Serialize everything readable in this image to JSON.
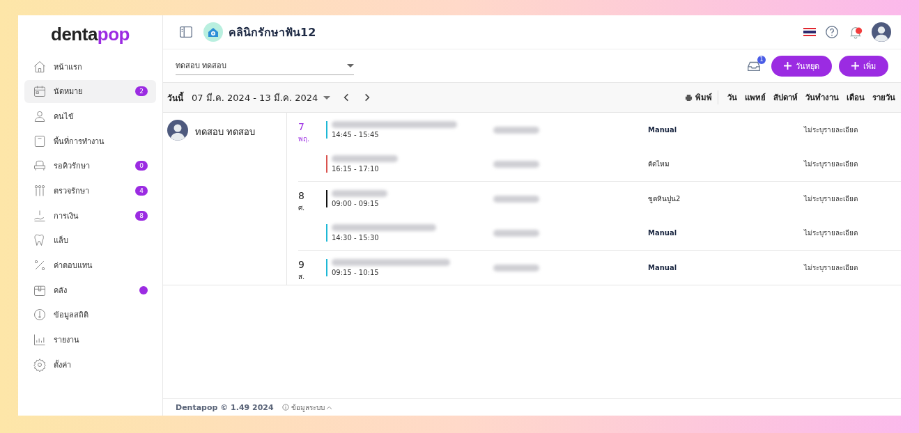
{
  "logo": {
    "part_1": "denta",
    "part_2": "pop"
  },
  "sidebar": {
    "items": [
      {
        "label": "หน้าแรก",
        "selected": false
      },
      {
        "label": "นัดหมาย",
        "selected": true,
        "badge": "2"
      },
      {
        "label": "คนไข้",
        "selected": false
      },
      {
        "label": "พื้นที่การทำงาน",
        "selected": false
      },
      {
        "label": "รอคิวรักษา",
        "selected": false,
        "badge": "0"
      },
      {
        "label": "ตรวจรักษา",
        "selected": false,
        "badge": "4"
      },
      {
        "label": "การเงิน",
        "selected": false,
        "badge": "8"
      },
      {
        "label": "แล็บ",
        "selected": false
      },
      {
        "label": "ค่าตอบแทน",
        "selected": false
      },
      {
        "label": "คลัง",
        "selected": false,
        "dot": true
      },
      {
        "label": "ข้อมูลสถิติ",
        "selected": false
      },
      {
        "label": "รายงาน",
        "selected": false
      },
      {
        "label": "ตั้งค่า",
        "selected": false
      }
    ]
  },
  "header": {
    "clinic_name": "คลินิกรักษาฟัน12",
    "notifications_unread": true
  },
  "toolbar": {
    "doctor_select": {
      "value": "ทดสอบ ทดสอบ"
    },
    "inbox_count": "1",
    "buttons": [
      "วันหยุด",
      "เพิ่ม"
    ]
  },
  "calendar_bar": {
    "today": "วันนี้",
    "range": "07 มี.ค. 2024 - 13 มี.ค. 2024",
    "print": "พิมพ์",
    "views": [
      {
        "label": "วัน",
        "selected": false
      },
      {
        "label": "แพทย์",
        "selected": false
      },
      {
        "label": "สัปดาห์",
        "selected": false
      },
      {
        "label": "วันทำงาน",
        "selected": false
      },
      {
        "label": "เดือน",
        "selected": false
      },
      {
        "label": "รายวัน",
        "selected": false
      }
    ]
  },
  "doctor": {
    "name": "ทดสอบ ทดสอบ"
  },
  "days": [
    {
      "day": "7",
      "weekday": "พฤ.",
      "today": true,
      "appointments": [
        {
          "time": "14:45 - 15:45",
          "color": "#1eb8d6",
          "type": "Manual",
          "emphasized": true,
          "detail": "ไม่ระบุรายละเอียด"
        },
        {
          "time": "16:15 - 17:10",
          "color": "#d9534f",
          "type": "ตัดไหม",
          "emphasized": false,
          "detail": "ไม่ระบุรายละเอียด"
        }
      ]
    },
    {
      "day": "8",
      "weekday": "ศ.",
      "today": false,
      "appointments": [
        {
          "time": "09:00 - 09:15",
          "color": "#111111",
          "type": "ขูดหินปูน2",
          "emphasized": false,
          "detail": "ไม่ระบุรายละเอียด"
        },
        {
          "time": "14:30 - 15:30",
          "color": "#1eb8d6",
          "type": "Manual",
          "emphasized": true,
          "detail": "ไม่ระบุรายละเอียด"
        }
      ]
    },
    {
      "day": "9",
      "weekday": "ส.",
      "today": false,
      "appointments": [
        {
          "time": "09:15 - 10:15",
          "color": "#1eb8d6",
          "type": "Manual",
          "emphasized": true,
          "detail": "ไม่ระบุรายละเอียด"
        }
      ]
    }
  ],
  "footer": {
    "version": "Dentapop © 1.49 2024",
    "system_info": "ข้อมูลระบบ"
  }
}
